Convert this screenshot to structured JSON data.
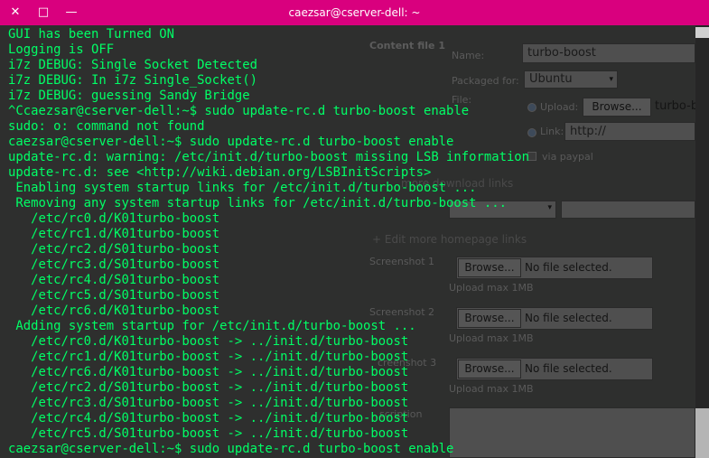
{
  "window": {
    "title": "caezsar@cserver-dell: ~",
    "close_glyph": "✕",
    "maximize_glyph": "□",
    "minimize_glyph": "—"
  },
  "terminal_lines": [
    "GUI has been Turned ON",
    "Logging is OFF",
    "i7z DEBUG: Single Socket Detected",
    "i7z DEBUG: In i7z Single_Socket()",
    "i7z DEBUG: guessing Sandy Bridge",
    "^Ccaezsar@cserver-dell:~$ sudo update-rc.d turbo-boost enable",
    "sudo: o: command not found",
    "caezsar@cserver-dell:~$ sudo update-rc.d turbo-boost enable",
    "update-rc.d: warning: /etc/init.d/turbo-boost missing LSB information",
    "update-rc.d: see <http://wiki.debian.org/LSBInitScripts>",
    " Enabling system startup links for /etc/init.d/turbo-boost ...",
    " Removing any system startup links for /etc/init.d/turbo-boost ...",
    "   /etc/rc0.d/K01turbo-boost",
    "   /etc/rc1.d/K01turbo-boost",
    "   /etc/rc2.d/S01turbo-boost",
    "   /etc/rc3.d/S01turbo-boost",
    "   /etc/rc4.d/S01turbo-boost",
    "   /etc/rc5.d/S01turbo-boost",
    "   /etc/rc6.d/K01turbo-boost",
    " Adding system startup for /etc/init.d/turbo-boost ...",
    "   /etc/rc0.d/K01turbo-boost -> ../init.d/turbo-boost",
    "   /etc/rc1.d/K01turbo-boost -> ../init.d/turbo-boost",
    "   /etc/rc6.d/K01turbo-boost -> ../init.d/turbo-boost",
    "   /etc/rc2.d/S01turbo-boost -> ../init.d/turbo-boost",
    "   /etc/rc3.d/S01turbo-boost -> ../init.d/turbo-boost",
    "   /etc/rc4.d/S01turbo-boost -> ../init.d/turbo-boost",
    "   /etc/rc5.d/S01turbo-boost -> ../init.d/turbo-boost",
    "caezsar@cserver-dell:~$ sudo update-rc.d turbo-boost enable"
  ],
  "background_form": {
    "section_title": "Content file 1",
    "name_label": "Name:",
    "name_value": "turbo-boost",
    "packaged_for_label": "Packaged for:",
    "packaged_for_value": "Ubuntu",
    "file_label": "File:",
    "upload_label": "Upload:",
    "browse_label": "Browse...",
    "upload_value": "turbo-b",
    "link_label": "Link:",
    "link_value": "http://",
    "paypal_label": "via paypal",
    "download_links_label": "more download links",
    "homepage_links_label": "+ Edit more homepage links",
    "screenshot1_label": "Screenshot 1",
    "screenshot2_label": "Screenshot 2",
    "screenshot3_label": "creenshot 3",
    "no_file_label": "No file selected.",
    "upload_max_label": "Upload max 1MB",
    "description_label": "scription"
  },
  "colors": {
    "titlebar": "#d9007e",
    "terminal_text": "#00ff66",
    "terminal_bg": "#2e2f2e"
  }
}
